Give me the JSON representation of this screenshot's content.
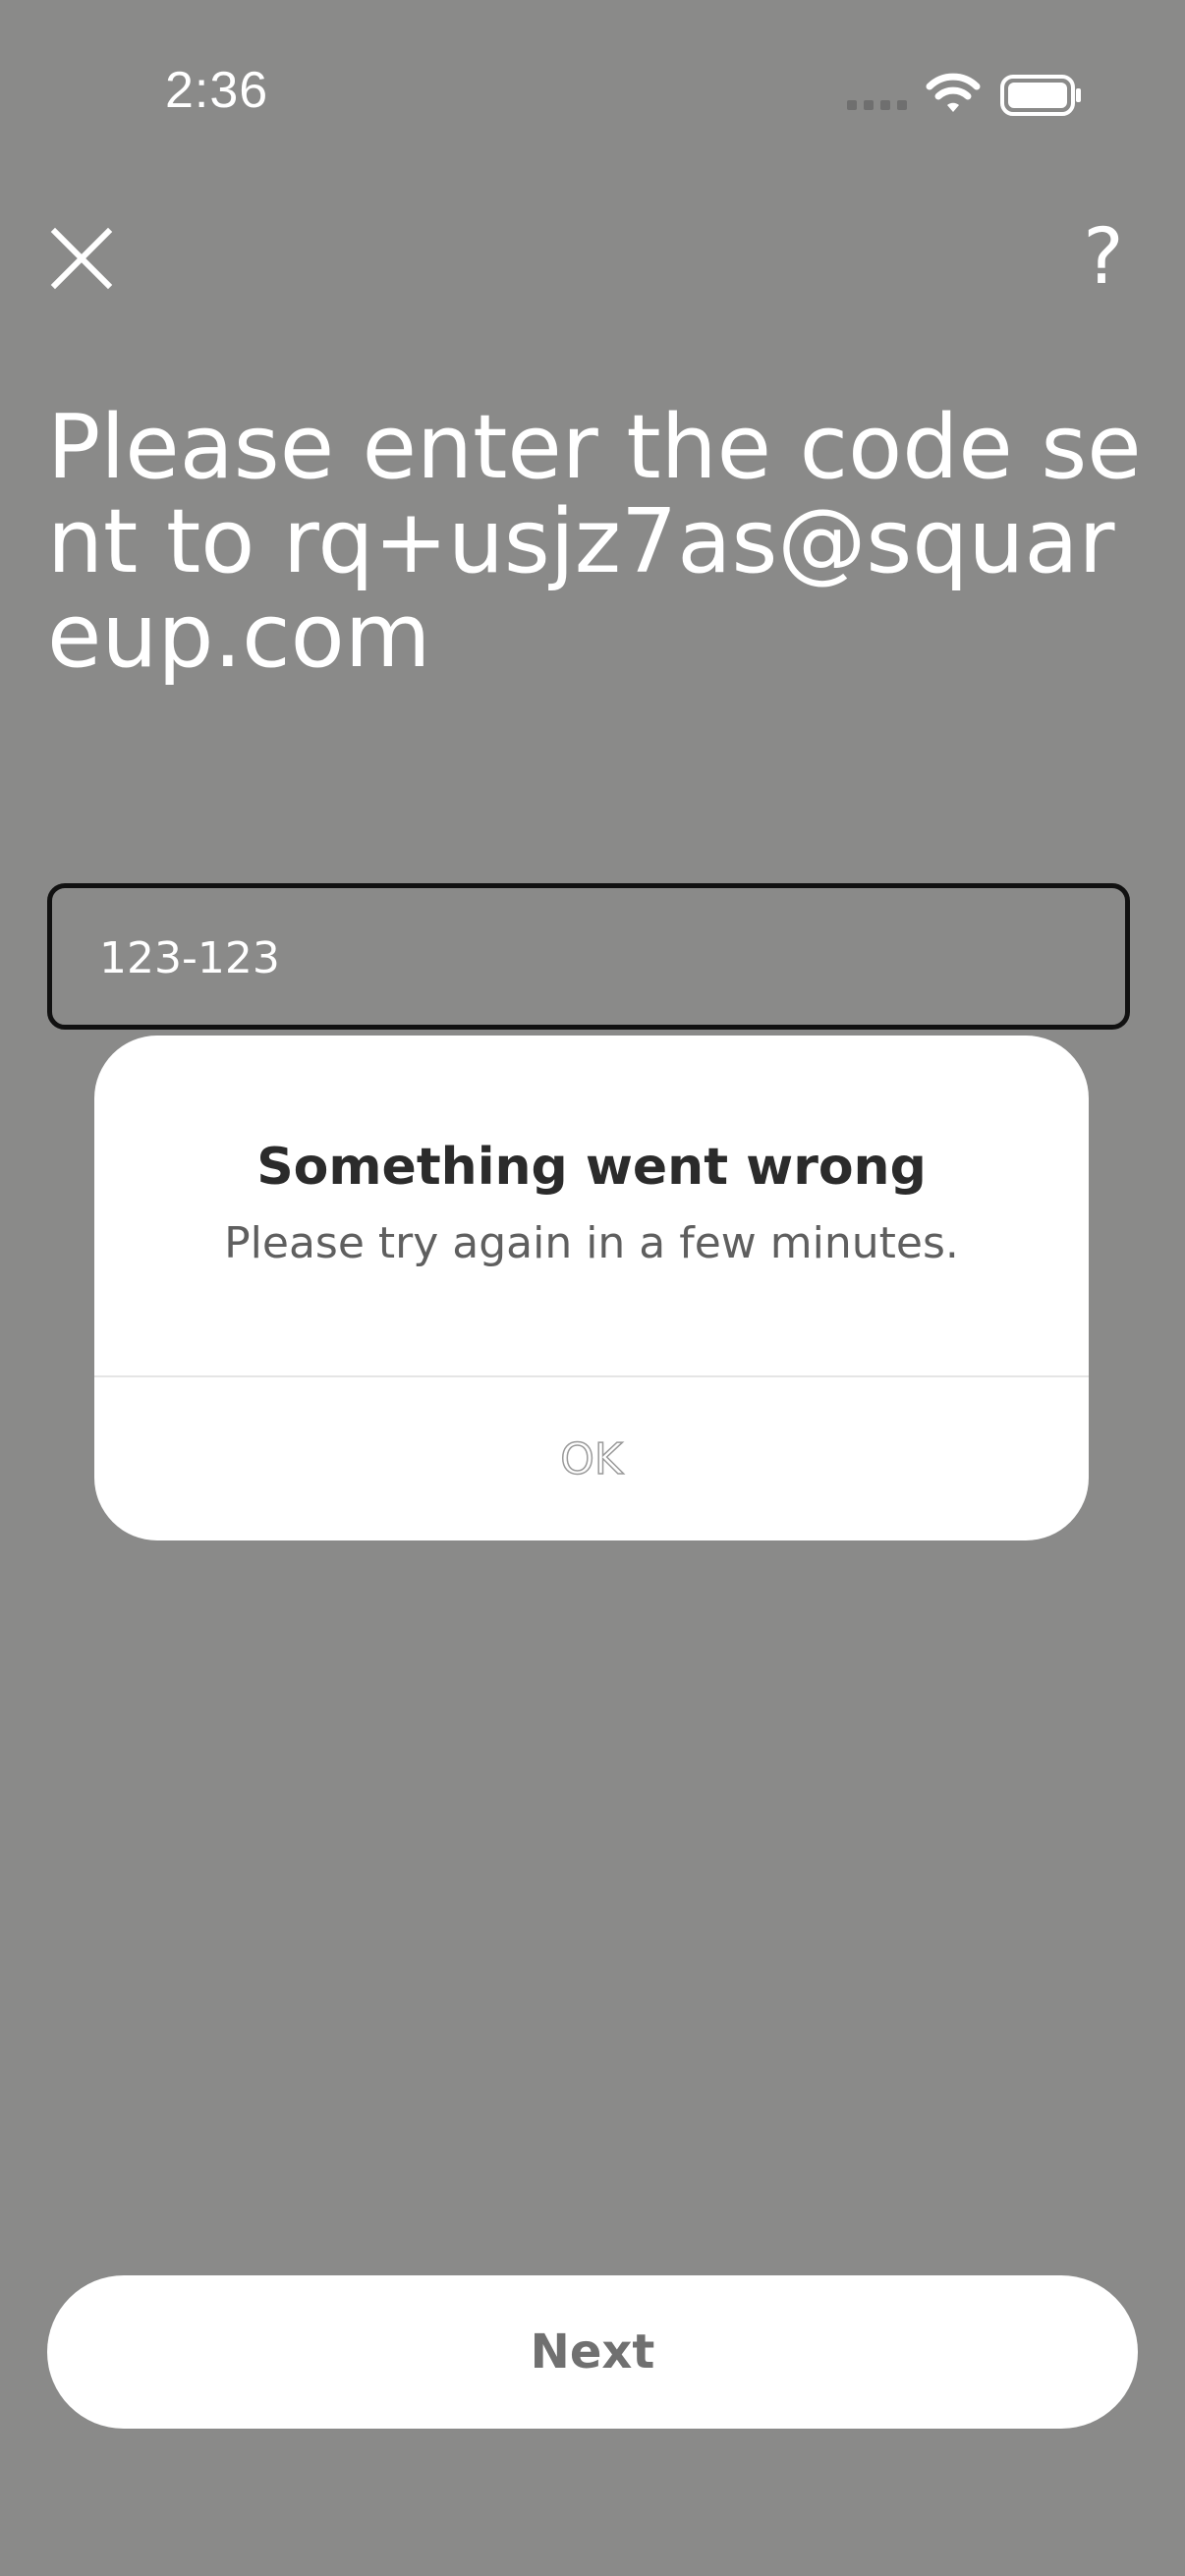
{
  "status_bar": {
    "time": "2:36"
  },
  "icons": {
    "close": "close-icon",
    "help": "help-icon",
    "signal": "cellular-signal-icon",
    "wifi": "wifi-icon",
    "battery": "battery-icon"
  },
  "header": {
    "help_label": "?"
  },
  "main": {
    "heading": "Please enter the code sent to rq+usjz7as@squareup.com",
    "code_field": {
      "placeholder": "123-123",
      "value": ""
    }
  },
  "dialog": {
    "title": "Something went wrong",
    "message": "Please try again in a few minutes.",
    "ok_label": "OK"
  },
  "footer": {
    "next_label": "Next"
  },
  "colors": {
    "background": "#8a8a89",
    "surface": "#ffffff",
    "field_border": "#111111",
    "dialog_title": "#2b2b2b",
    "dialog_message": "#5f5f5f",
    "next_text": "#707070"
  }
}
